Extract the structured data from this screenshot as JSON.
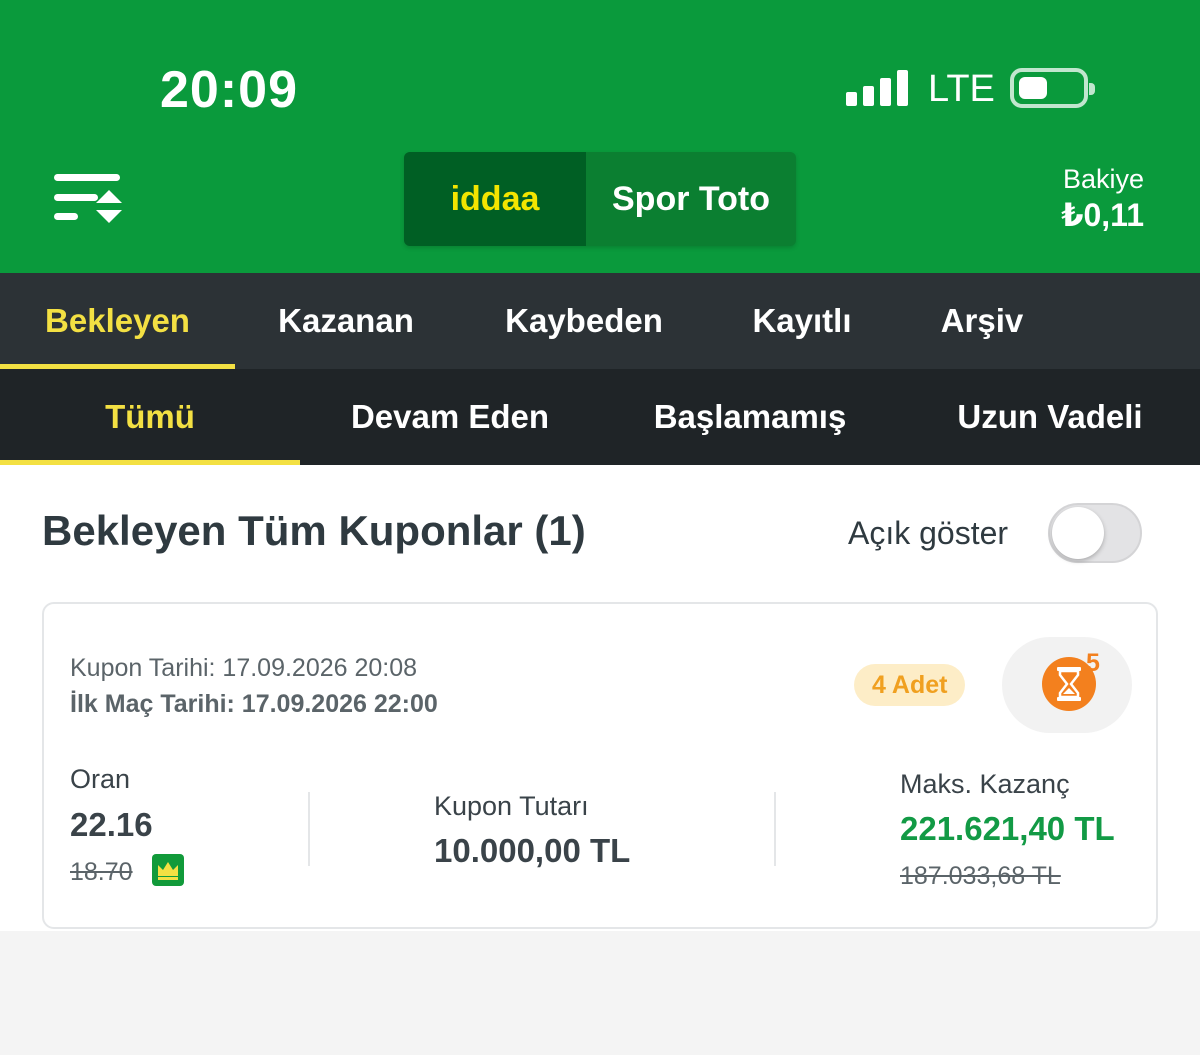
{
  "status_bar": {
    "time": "20:09",
    "network": "LTE"
  },
  "header": {
    "segments": [
      {
        "label": "iddaa",
        "active": true
      },
      {
        "label": "Spor Toto",
        "active": false
      }
    ],
    "balance_label": "Bakiye",
    "balance_value": "₺0,11"
  },
  "tabs_primary": [
    {
      "label": "Bekleyen",
      "active": true
    },
    {
      "label": "Kazanan",
      "active": false
    },
    {
      "label": "Kaybeden",
      "active": false
    },
    {
      "label": "Kayıtlı",
      "active": false
    },
    {
      "label": "Arşiv",
      "active": false
    }
  ],
  "tabs_secondary": [
    {
      "label": "Tümü",
      "active": true
    },
    {
      "label": "Devam Eden",
      "active": false
    },
    {
      "label": "Başlamamış",
      "active": false
    },
    {
      "label": "Uzun Vadeli",
      "active": false
    }
  ],
  "section": {
    "title": "Bekleyen Tüm Kuponlar (1)",
    "toggle_label": "Açık göster",
    "toggle_on": false
  },
  "coupon": {
    "kupon_tarihi": "Kupon Tarihi: 17.09.2026 20:08",
    "ilk_mac_tarihi": "İlk Maç Tarihi: 17.09.2026 22:00",
    "adet": "4 Adet",
    "timer_count": "5",
    "oran_label": "Oran",
    "oran_value": "22.16",
    "oran_old": "18.70",
    "tutar_label": "Kupon Tutarı",
    "tutar_value": "10.000,00 TL",
    "kazanc_label": "Maks. Kazanç",
    "kazanc_value": "221.621,40 TL",
    "kazanc_old": "187.033,68 TL"
  },
  "colors": {
    "header_green": "#0a9a3c",
    "accent_yellow": "#f3e043",
    "win_green": "#129a45",
    "timer_orange": "#f3801e"
  }
}
